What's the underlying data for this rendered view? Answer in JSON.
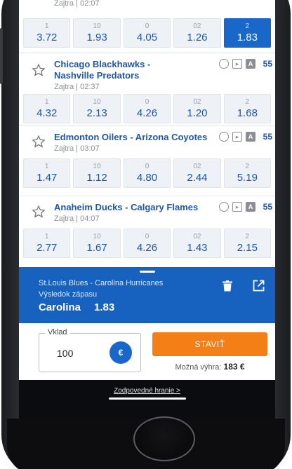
{
  "top_row": {
    "time": "Zajtra | 02:07",
    "odds": [
      {
        "label": "1",
        "value": "3.72"
      },
      {
        "label": "10",
        "value": "1.93"
      },
      {
        "label": "0",
        "value": "4.05"
      },
      {
        "label": "02",
        "value": "1.26"
      },
      {
        "label": "2",
        "value": "1.83",
        "selected": true
      }
    ]
  },
  "matches": [
    {
      "teams_line1": "Chicago Blackhawks -",
      "teams_line2": "Nashville Predators",
      "time": "Zajtra | 02:37",
      "count": "55",
      "odds": [
        {
          "label": "1",
          "value": "4.32"
        },
        {
          "label": "10",
          "value": "2.13"
        },
        {
          "label": "0",
          "value": "4.26"
        },
        {
          "label": "02",
          "value": "1.20"
        },
        {
          "label": "2",
          "value": "1.68"
        }
      ]
    },
    {
      "teams_line1": "Edmonton Oilers - Arizona Coyotes",
      "time": "Zajtra | 03:07",
      "count": "55",
      "odds": [
        {
          "label": "1",
          "value": "1.47"
        },
        {
          "label": "10",
          "value": "1.12"
        },
        {
          "label": "0",
          "value": "4.80"
        },
        {
          "label": "02",
          "value": "2.44"
        },
        {
          "label": "2",
          "value": "5.19"
        }
      ]
    },
    {
      "teams_line1": "Anaheim Ducks - Calgary Flames",
      "time": "Zajtra | 04:07",
      "count": "55",
      "odds": [
        {
          "label": "1",
          "value": "2.77"
        },
        {
          "label": "10",
          "value": "1.67"
        },
        {
          "label": "0",
          "value": "4.26"
        },
        {
          "label": "02",
          "value": "1.43"
        },
        {
          "label": "2",
          "value": "2.15"
        }
      ]
    }
  ],
  "icons": {
    "timer": "stopwatch-icon",
    "tv": "tv-icon",
    "stats": "a-badge-icon",
    "star": "star-outline-icon",
    "trash": "trash-icon",
    "open": "open-external-icon"
  },
  "icon_glyphs": {
    "a_badge": "A"
  },
  "slip": {
    "match": "St.Louis Blues - Carolina Hurricanes",
    "type": "Výsledok zápasu",
    "selection": "Carolina",
    "odd": "1.83",
    "stake_label": "Vklad",
    "stake_value": "100",
    "currency": "€",
    "bet_label": "STAVIŤ",
    "win_label": "Možná výhra:",
    "win_value": "183 €"
  },
  "footer": {
    "responsible": "Zodpovedné hranie >"
  },
  "colors": {
    "accent": "#1967c9",
    "bet_button": "#f57f17",
    "slip_bg": "#1762bf",
    "team_text": "#1f57a8"
  }
}
